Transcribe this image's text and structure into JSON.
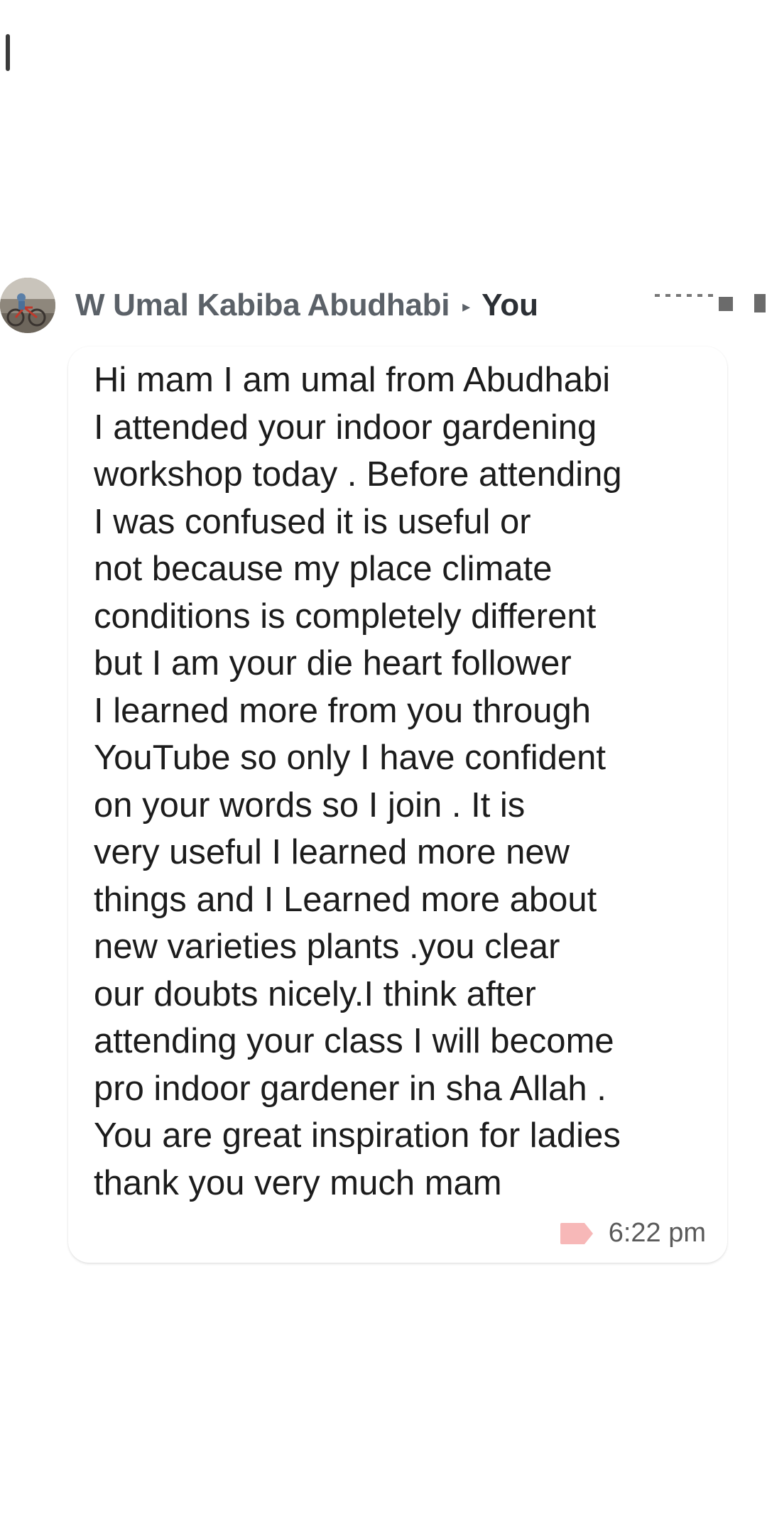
{
  "header": {
    "sender_name": "W Umal Kabiba Abudhabi",
    "arrow_icon": "caret-right-icon",
    "recipient": "You"
  },
  "message": {
    "text": "Hi mam I am umal from Abudhabi\nI attended your indoor gardening\nworkshop today . Before attending\nI was confused it is useful or\nnot because my place climate\nconditions is completely different\nbut I am your die heart follower\nI learned more from you through\nYouTube so only I have confident\non your words so I join . It is\nvery useful I learned more new\nthings and I Learned more about\nnew varieties plants .you clear\nour doubts nicely.I think after\nattending your class I will become\npro indoor gardener in sha Allah .\nYou are great inspiration for ladies\nthank you very much mam",
    "time": "6:22 pm",
    "label_icon": "label-tag-icon",
    "label_color": "#f7b8b8"
  },
  "colors": {
    "sender": "#5b6168",
    "recipient": "#2c3035",
    "message_text": "#1c1c1c",
    "time_text": "#5a5a5a"
  }
}
